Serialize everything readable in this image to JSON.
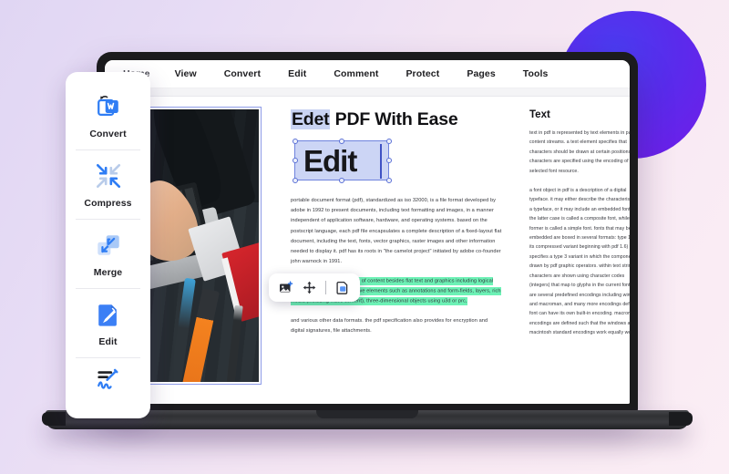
{
  "app": {
    "menu": [
      {
        "label": "Home"
      },
      {
        "label": "View"
      },
      {
        "label": "Convert"
      },
      {
        "label": "Edit"
      },
      {
        "label": "Comment"
      },
      {
        "label": "Protect"
      },
      {
        "label": "Pages"
      },
      {
        "label": "Tools"
      }
    ]
  },
  "tool_panel": {
    "items": [
      {
        "label": "Convert",
        "icon": "convert-to-word-icon"
      },
      {
        "label": "Compress",
        "icon": "compress-arrows-icon"
      },
      {
        "label": "Merge",
        "icon": "merge-squares-icon"
      },
      {
        "label": "Edit",
        "icon": "edit-document-pencil-icon"
      },
      {
        "label": "",
        "icon": "sign-signature-icon"
      }
    ]
  },
  "document": {
    "heading_selected": "Edet",
    "heading_rest": " PDF With Ease",
    "edit_box_text": "Edit",
    "paragraphs": [
      "portable document format (pdf), standardized as iso 32000, is a file format developed by adobe in 1992 to present documents, including text formatting and images, in a manner independent of application software, hardware, and operating systems. based on the postscript language, each pdf file encapsulates a complete description of a fixed-layout flat document, including the text, fonts, vector graphics, raster images and other information needed to display it. pdf has its roots in \"the camelot project\" initiated by adobe co-founder john warnock in 1991.",
      "pdf files may contain a variety of content besides flat text and graphics including logical structuring elements, interactive elements such as annotations and form-fields, layers, rich media (including video content), three-dimensional objects using u3d or prc,",
      "and various other data formats. the pdf specification also provides for encryption and digital signatures, file attachments."
    ],
    "highlight_color": "#6df2b6",
    "selection_color": "#c9d3f3"
  },
  "object_toolbar": {
    "buttons": [
      {
        "icon": "add-image-icon"
      },
      {
        "icon": "move-arrows-icon"
      },
      {
        "icon": "divider"
      },
      {
        "icon": "copy-duplicate-icon"
      }
    ]
  },
  "side_panel": {
    "title": "Text",
    "paragraphs": [
      "text in pdf is represented by text elements in page content streams. a text element specifies that characters should be drawn at certain positions. the characters are specified using the encoding of a selected font resource.",
      "a font object in pdf is a description of a digital typeface. it may either describe the characteristics of a typeface, or it may include an embedded font file. the latter case is called a composite font, while the former is called a simple font. fonts that may be embedded are boxed in several formats: type 1 (and its compressed variant beginning with pdf 1.6) specifies a type 3 variant in which the components are drawn by pdf graphic operators. within text strings, characters are shown using character codes (integers) that map to glyphs in the current font. there are several predefined encodings including winansi and macroman, and many more encodings defined. a font can have its own built-in encoding. macroman encodings are defined such that the windows and macintosh standard encodings work equally well."
    ]
  },
  "decor": {
    "circle_color": "#5a2bec",
    "background": "#e7dcf5"
  }
}
